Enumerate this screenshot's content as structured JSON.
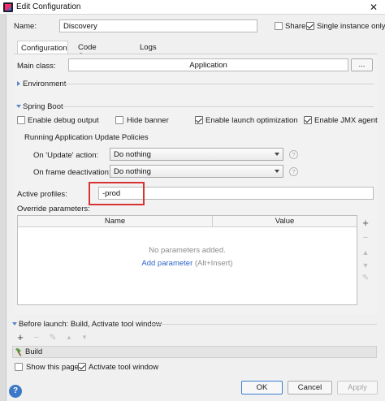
{
  "window": {
    "title": "Edit Configuration",
    "close_glyph": "✕"
  },
  "header": {
    "name_label": "Name:",
    "name_value": "Discovery",
    "share_label": "Share",
    "share_checked": false,
    "single_instance_label": "Single instance only",
    "single_instance_checked": true
  },
  "tabs": [
    {
      "label": "Configuration",
      "active": true
    },
    {
      "label": "Code Coverage",
      "active": false
    },
    {
      "label": "Logs",
      "active": false
    }
  ],
  "config": {
    "main_class_label": "Main class:",
    "main_class_value": "Application",
    "main_class_button": "...",
    "environment_label": "Environment",
    "spring_boot_label": "Spring Boot",
    "options": [
      {
        "label": "Enable debug output",
        "checked": false
      },
      {
        "label": "Hide banner",
        "checked": false
      },
      {
        "label": "Enable launch optimization",
        "checked": true
      },
      {
        "label": "Enable JMX agent",
        "checked": true
      }
    ],
    "update_policies_label": "Running Application Update Policies",
    "on_update_label": "On 'Update' action:",
    "on_update_value": "Do nothing",
    "on_frame_label": "On frame deactivation:",
    "on_frame_value": "Do nothing",
    "help_glyph": "?",
    "active_profiles_label": "Active profiles:",
    "active_profiles_value": "-prod",
    "override_label": "Override parameters:",
    "table": {
      "columns": [
        "Name",
        "Value"
      ],
      "empty_text": "No parameters added.",
      "add_link": "Add parameter",
      "add_shortcut": "(Alt+Insert)"
    }
  },
  "before_launch": {
    "label": "Before launch: Build, Activate tool window",
    "task": "Build"
  },
  "footer": {
    "show_page_label": "Show this page",
    "show_page_checked": false,
    "activate_tool_label": "Activate tool window",
    "activate_tool_checked": true,
    "ok_label": "OK",
    "cancel_label": "Cancel",
    "apply_label": "Apply",
    "help_glyph": "?"
  },
  "icons": {
    "add": "+",
    "remove": "−",
    "edit": "✎",
    "up": "▲",
    "down": "▼"
  },
  "colors": {
    "accent_blue": "#5b86c5",
    "link": "#2c63c6",
    "highlight_red": "#d93232",
    "ok_border": "#3c7fd3"
  }
}
